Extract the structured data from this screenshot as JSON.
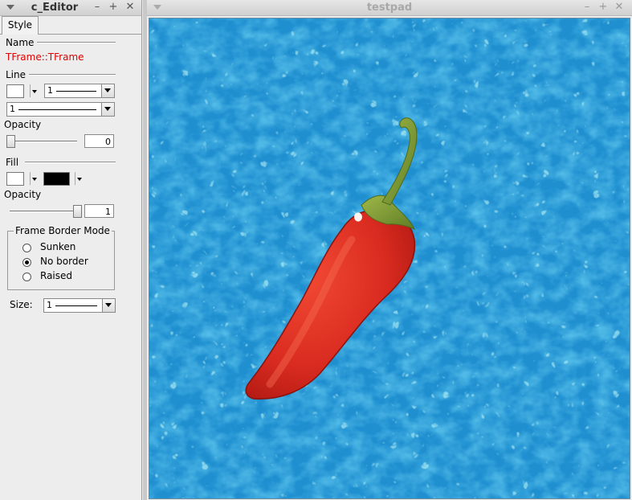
{
  "editor": {
    "title": "c_Editor",
    "tab": "Style",
    "name_label": "Name",
    "name_value": "TFrame::TFrame",
    "line_label": "Line",
    "line_width_value": "1",
    "line_style_value": "1",
    "opacity_label": "Opacity",
    "line_opacity_value": "0",
    "fill_label": "Fill",
    "fill_opacity_label": "Opacity",
    "fill_opacity_value": "1",
    "frame_border_mode_label": "Frame Border Mode",
    "border_modes": [
      "Sunken",
      "No border",
      "Raised"
    ],
    "selected_border_mode": "No border",
    "size_label": "Size:",
    "size_value": "1",
    "line_opacity": 0,
    "fill_opacity": 1,
    "line_color": "#ffffff",
    "fill_colors": [
      "#ffffff",
      "#000000"
    ]
  },
  "testpad": {
    "title": "testpad",
    "image_subject": "red chili pepper on blue water background"
  },
  "window_buttons": {
    "minimize": "–",
    "maximize": "+",
    "close": "✕"
  },
  "colors": {
    "accent_red": "#e00000",
    "water": "#2a9ad8",
    "pepper": "#e03020"
  }
}
